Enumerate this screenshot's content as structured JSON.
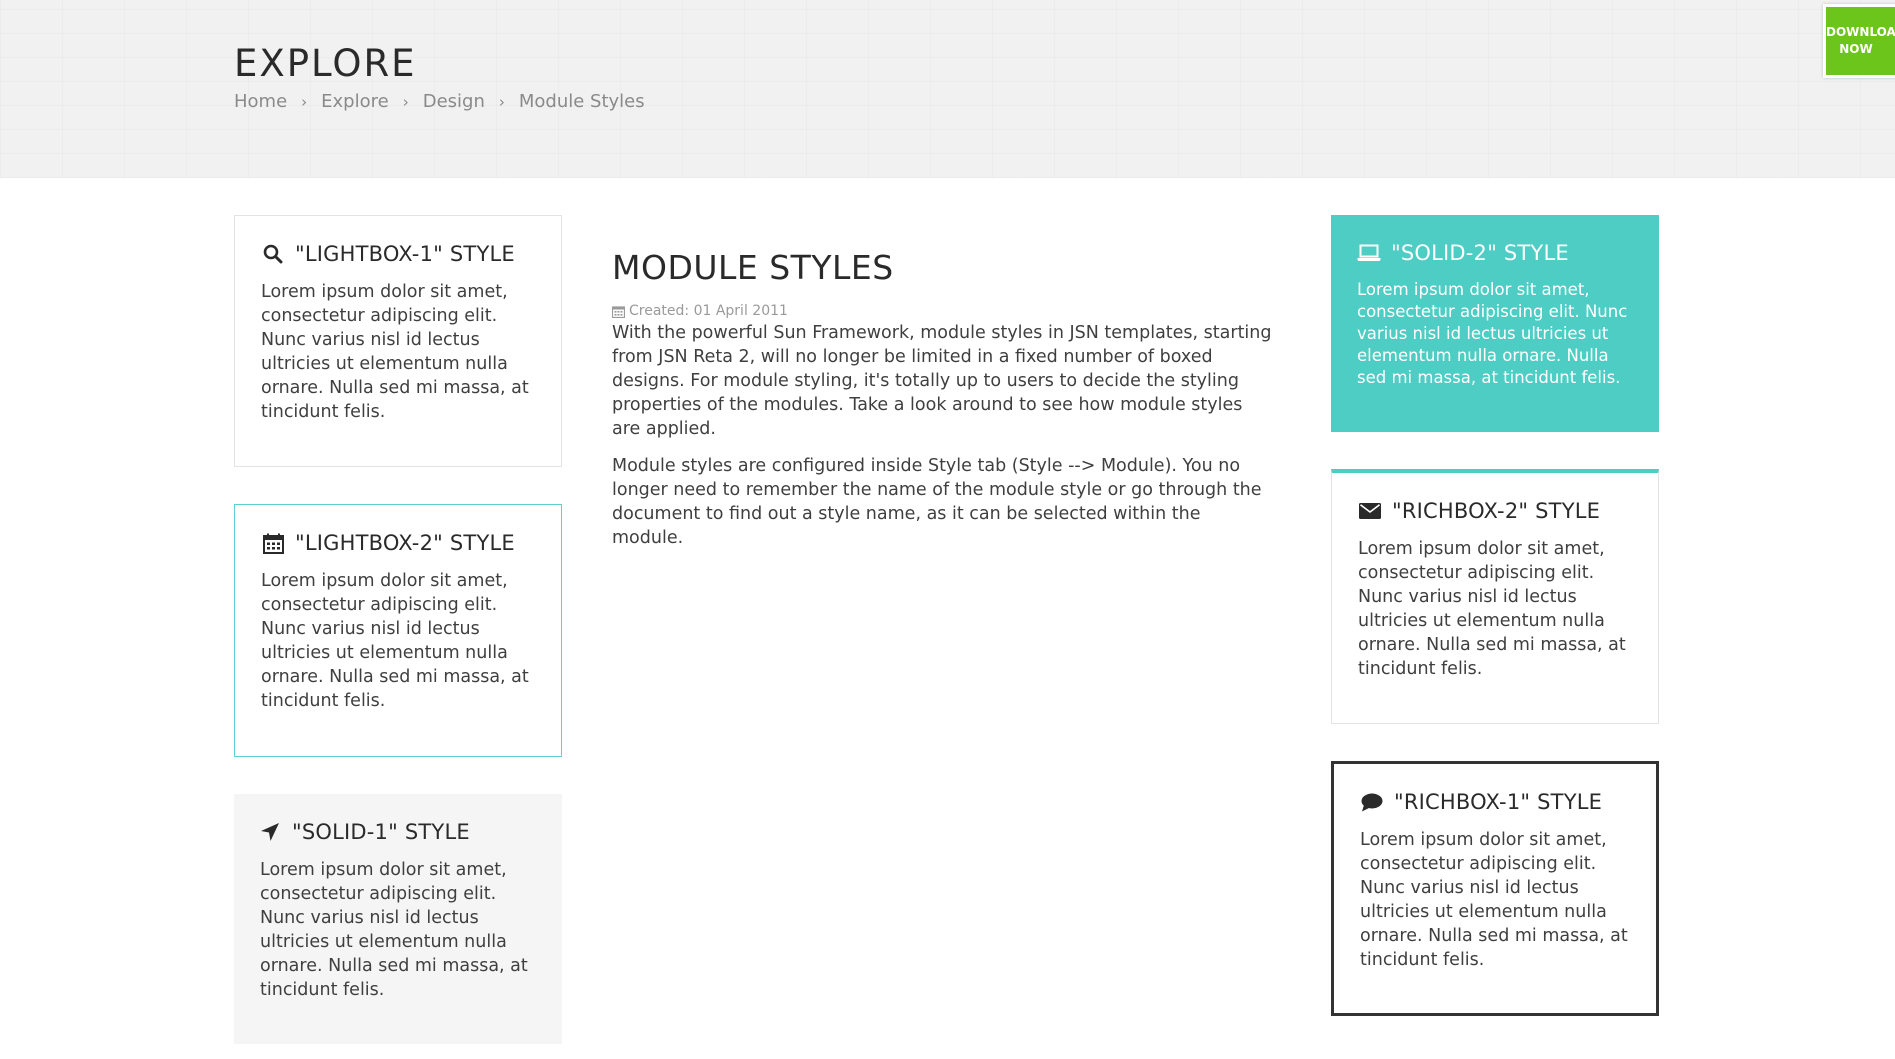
{
  "header": {
    "title": "EXPLORE",
    "breadcrumb": [
      "Home",
      "Explore",
      "Design",
      "Module Styles"
    ],
    "download_line1": "DOWNLOA",
    "download_line2": "NOW"
  },
  "article": {
    "title": "MODULE STYLES",
    "created": "Created: 01 April 2011",
    "paragraph1": "With the powerful Sun Framework, module styles in JSN templates, starting from JSN Reta 2, will no longer be limited in a fixed number of boxed designs. For module styling, it's totally up to users to decide the styling properties of the modules. Take a look around to see how module styles are applied.",
    "paragraph2": "Module styles are configured inside Style tab (Style --> Module). You no longer need to remember the name of the module style or go through the document to find out a style name, as it can be selected within the module."
  },
  "modules": [
    {
      "title": "\"LIGHTBOX-1\" STYLE",
      "icon": "search-icon",
      "body": "Lorem ipsum dolor sit amet, consectetur adipiscing elit. Nunc varius nisl id lectus ultricies ut elementum nulla ornare. Nulla sed mi massa, at tincidunt felis."
    },
    {
      "title": "\"LIGHTBOX-2\" STYLE",
      "icon": "calendar-icon",
      "body": "Lorem ipsum dolor sit amet, consectetur adipiscing elit. Nunc varius nisl id lectus ultricies ut elementum nulla ornare. Nulla sed mi massa, at tincidunt felis."
    },
    {
      "title": "\"SOLID-1\" STYLE",
      "icon": "location-arrow-icon",
      "body": "Lorem ipsum dolor sit amet, consectetur adipiscing elit. Nunc varius nisl id lectus ultricies ut elementum nulla ornare. Nulla sed mi massa, at tincidunt felis."
    },
    {
      "title": "\"SOLID-2\" STYLE",
      "icon": "laptop-icon",
      "body": "Lorem ipsum dolor sit amet, consectetur adipiscing elit. Nunc varius nisl id lectus ultricies ut elementum nulla ornare. Nulla sed mi massa, at tincidunt felis."
    },
    {
      "title": "\"RICHBOX-2\" STYLE",
      "icon": "envelope-icon",
      "body": "Lorem ipsum dolor sit amet, consectetur adipiscing elit. Nunc varius nisl id lectus ultricies ut elementum nulla ornare. Nulla sed mi massa, at tincidunt felis."
    },
    {
      "title": "\"RICHBOX-1\" STYLE",
      "icon": "comment-icon",
      "body": "Lorem ipsum dolor sit amet, consectetur adipiscing elit. Nunc varius nisl id lectus ultricies ut elementum nulla ornare. Nulla sed mi massa, at tincidunt felis."
    }
  ],
  "colors": {
    "accent_teal": "#4ecdc4",
    "download_green": "#6cc51a"
  }
}
